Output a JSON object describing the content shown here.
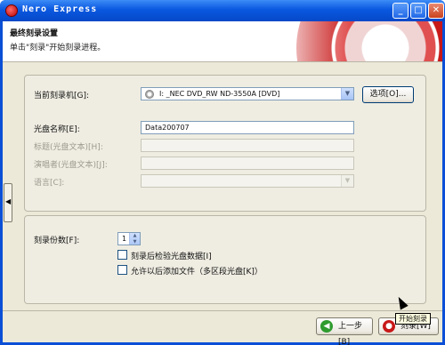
{
  "window": {
    "title": "Nero Express",
    "controls": {
      "minimize": "_",
      "maximize": "□",
      "close": "✕"
    }
  },
  "header": {
    "title": "最终刻录设置",
    "subtitle": "单击\"刻录\"开始刻录进程。"
  },
  "sidebar_toggle": {
    "arrow": "◀"
  },
  "recorder": {
    "label": "当前刻录机[G]:",
    "value": "I:  _NEC DVD_RW ND-3550A   [DVD]",
    "options_button": "选项[O]..."
  },
  "disc": {
    "name_label": "光盘名称[E]:",
    "name_value": "Data200707",
    "title_label": "标题(光盘文本)[H]:",
    "performer_label": "演唱者(光盘文本)[J]:",
    "language_label": "语言[C]:"
  },
  "burn": {
    "copies_label": "刻录份数[F]:",
    "copies_value": "1",
    "verify_label": "刻录后检验光盘数据[I]",
    "verify_checked": false,
    "multisession_label": "允许以后添加文件（多区段光盘[K]）",
    "multisession_checked": false
  },
  "nav": {
    "back_label": "上一步[B]",
    "burn_label": "刻录[W]",
    "tooltip": "开始刻录"
  },
  "colors": {
    "titlebar": "#0a58e0",
    "dialog": "#ece9d8",
    "accent_red": "#c81818"
  }
}
